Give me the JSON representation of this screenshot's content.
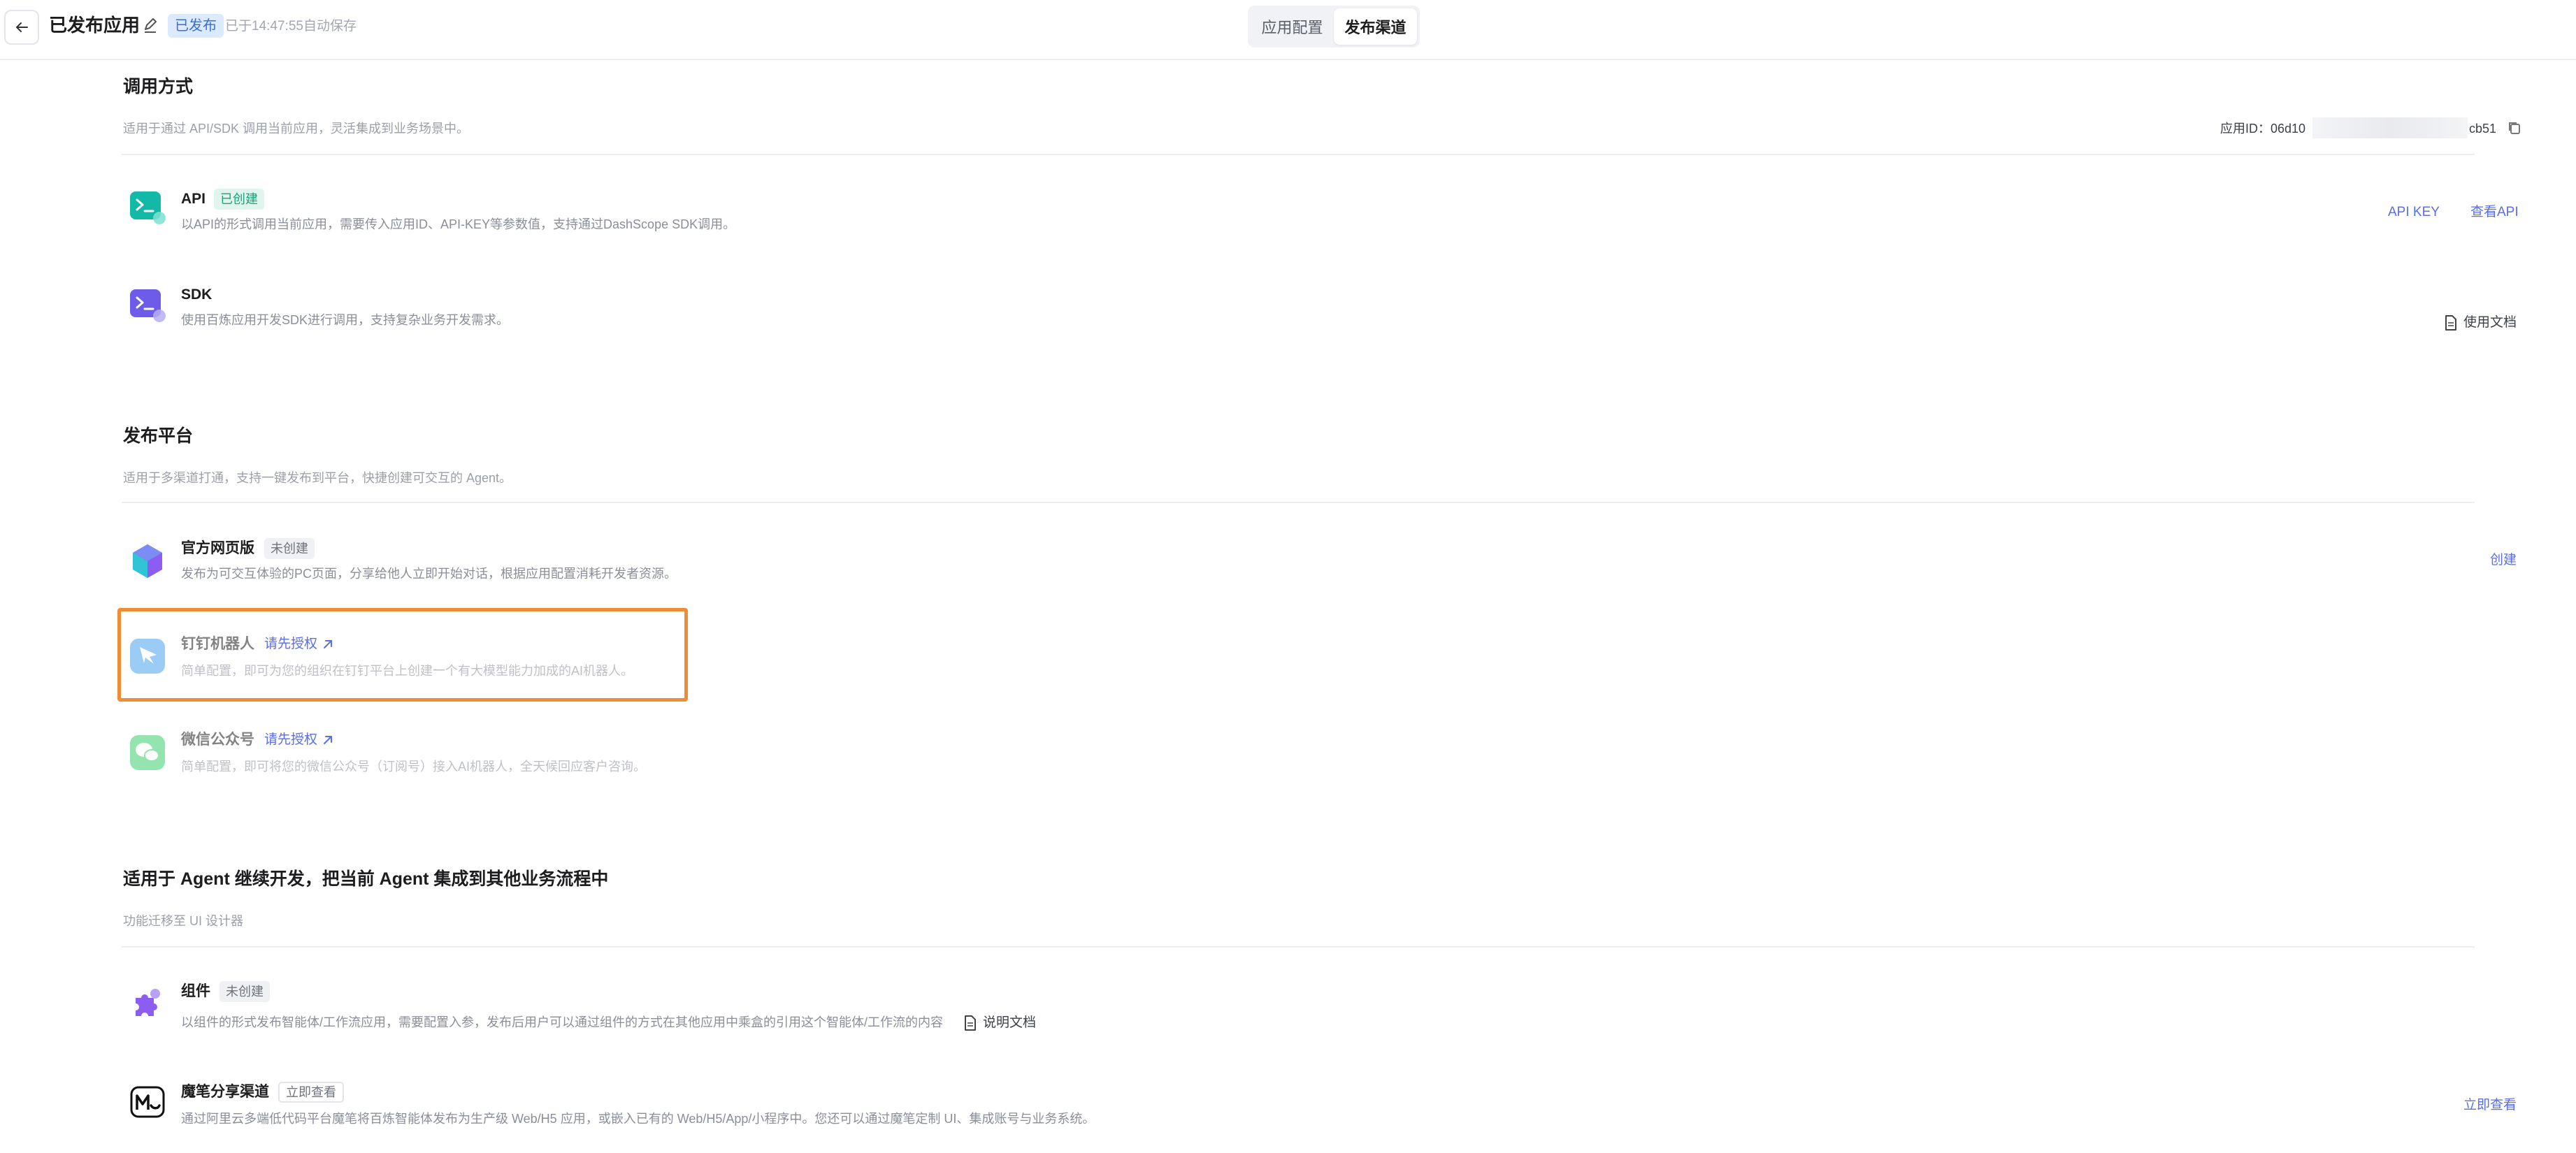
{
  "header": {
    "title": "已发布应用",
    "status": "已发布",
    "autosave": "已于14:47:55自动保存",
    "tabs": [
      "应用配置",
      "发布渠道"
    ],
    "active_tab": "发布渠道"
  },
  "invoke": {
    "title": "调用方式",
    "subtitle": "适用于通过 API/SDK 调用当前应用，灵活集成到业务场景中。",
    "app_id_label": "应用ID：06d10",
    "app_id_tail": "cb51",
    "items": [
      {
        "title": "API",
        "tag": "已创建",
        "desc": "以API的形式调用当前应用，需要传入应用ID、API-KEY等参数值，支持通过DashScope SDK调用。",
        "actions": [
          "API KEY",
          "查看API"
        ]
      },
      {
        "title": "SDK",
        "desc": "使用百炼应用开发SDK进行调用，支持复杂业务开发需求。",
        "actions": [
          "使用文档"
        ]
      }
    ]
  },
  "platform": {
    "title": "发布平台",
    "subtitle": "适用于多渠道打通，支持一键发布到平台，快捷创建可交互的 Agent。",
    "items": [
      {
        "title": "官方网页版",
        "tag": "未创建",
        "desc": "发布为可交互体验的PC页面，分享给他人立即开始对话，根据应用配置消耗开发者资源。",
        "action": "创建"
      },
      {
        "title": "钉钉机器人",
        "auth": "请先授权",
        "desc": "简单配置，即可为您的组织在钉钉平台上创建一个有大模型能力加成的AI机器人。"
      },
      {
        "title": "微信公众号",
        "auth": "请先授权",
        "desc": "简单配置，即可将您的微信公众号（订阅号）接入AI机器人，全天候回应客户咨询。"
      }
    ]
  },
  "agent": {
    "title": "适用于 Agent 继续开发，把当前 Agent 集成到其他业务流程中",
    "subtitle": "功能迁移至 UI 设计器",
    "items": [
      {
        "title": "组件",
        "tag": "未创建",
        "desc": "以组件的形式发布智能体/工作流应用，需要配置入参，发布后用户可以通过组件的方式在其他应用中乘盒的引用这个智能体/工作流的内容",
        "doc": "说明文档"
      },
      {
        "title": "魔笔分享渠道",
        "tag": "立即查看",
        "desc": "通过阿里云多端低代码平台魔笔将百炼智能体发布为生产级 Web/H5 应用，或嵌入已有的 Web/H5/App/小程序中。您还可以通过魔笔定制 UI、集成账号与业务系统。",
        "action": "立即查看"
      }
    ]
  },
  "colors": {
    "accent": "#5b6ee6",
    "highlight": "#f08c34",
    "api_icon": "#14b8a6",
    "sdk_icon": "#6d5ce8",
    "dingtalk_icon": "#4aa3f0",
    "wechat_icon": "#3ecf6e"
  }
}
